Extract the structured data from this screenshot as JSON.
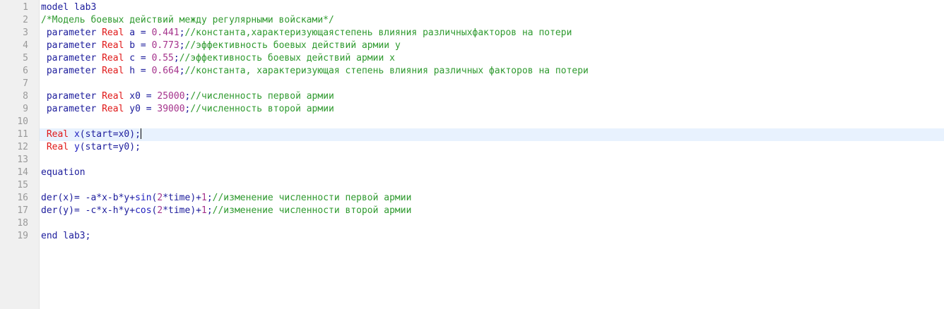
{
  "editor": {
    "line_numbers": [
      "1",
      "2",
      "3",
      "4",
      "5",
      "6",
      "7",
      "8",
      "9",
      "10",
      "11",
      "12",
      "13",
      "14",
      "15",
      "16",
      "17",
      "18",
      "19"
    ],
    "current_line": 11,
    "colors": {
      "gutter_bg": "#f0f0f0",
      "current_line_bg": "#e8f2fe",
      "keyword": "#1c1c9c",
      "type": "#e01818",
      "number": "#a5338c",
      "comment": "#2f9a2f"
    },
    "code": {
      "l1_kw": "model",
      "l1_name": " lab3",
      "l2_comment": "/*Модель боевых действий между регулярными войсками*/",
      "l3_kw": " parameter",
      "l3_type": " Real",
      "l3_rest": " a = ",
      "l3_num": "0.441",
      "l3_semi": ";",
      "l3_comment": "//константа,характеризующаястепень влияния различныхфакторов на потери",
      "l4_kw": " parameter",
      "l4_type": " Real",
      "l4_rest": " b = ",
      "l4_num": "0.773",
      "l4_semi": ";",
      "l4_comment": "//эффективность боевых действий армии y",
      "l5_kw": " parameter",
      "l5_type": " Real",
      "l5_rest": " c = ",
      "l5_num": "0.55",
      "l5_semi": ";",
      "l5_comment": "//эффективность боевых действий армии x",
      "l6_kw": " parameter",
      "l6_type": " Real",
      "l6_rest": " h = ",
      "l6_num": "0.664",
      "l6_semi": ";",
      "l6_comment": "//константа, характеризующая степень влияния различных факторов на потери",
      "l8_kw": " parameter",
      "l8_type": " Real",
      "l8_rest": " x0 = ",
      "l8_num": "25000",
      "l8_semi": ";",
      "l8_comment": "//численность первой армии",
      "l9_kw": " parameter",
      "l9_type": " Real",
      "l9_rest": " y0 = ",
      "l9_num": "39000",
      "l9_semi": ";",
      "l9_comment": "//численность второй армии",
      "l11_type": " Real",
      "l11_var": " x",
      "l11_rest": "(start=x0);",
      "l12_type": " Real",
      "l12_var": " y",
      "l12_rest": "(start=y0);",
      "l14_kw": "equation",
      "l16_a": "der(x)= -a*x-b*y+",
      "l16_fn": "sin",
      "l16_b": "(",
      "l16_n1": "2",
      "l16_c": "*time)+",
      "l16_n2": "1",
      "l16_semi": ";",
      "l16_comment": "//изменение численности первой армии",
      "l17_a": "der(y)= -c*x-h*y+",
      "l17_fn": "cos",
      "l17_b": "(",
      "l17_n1": "2",
      "l17_c": "*time)+",
      "l17_n2": "1",
      "l17_semi": ";",
      "l17_comment": "//изменение численности второй армии",
      "l19_kw": "end",
      "l19_name": " lab3;"
    }
  }
}
